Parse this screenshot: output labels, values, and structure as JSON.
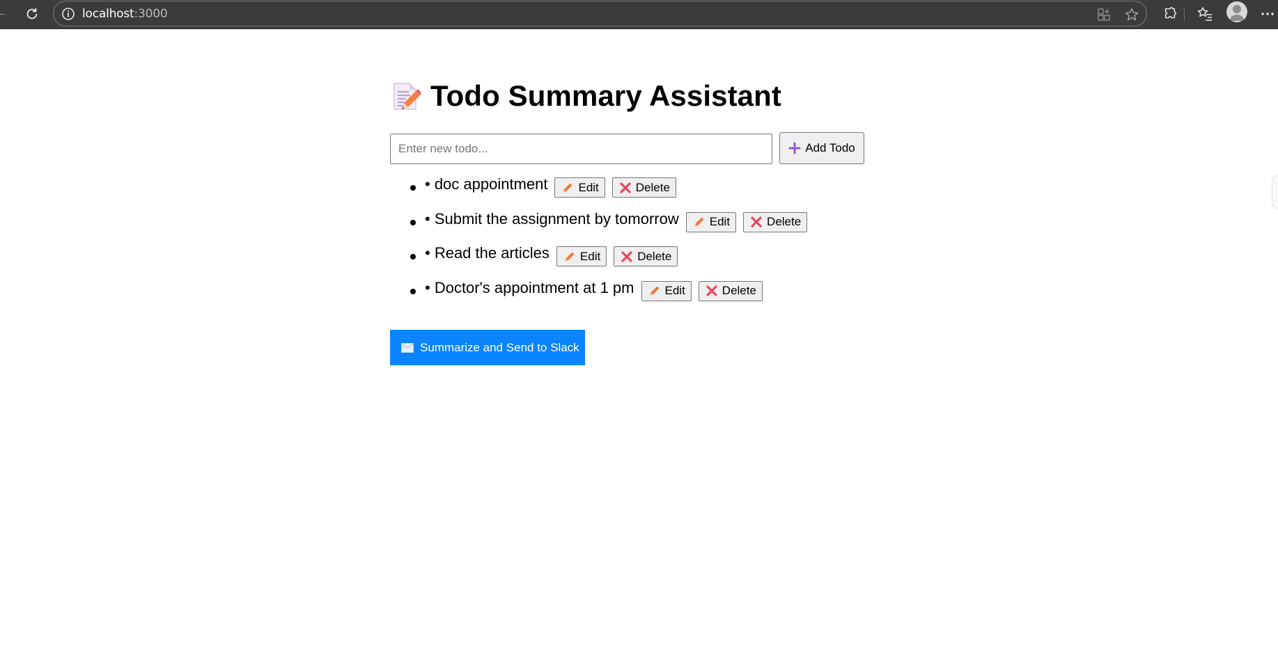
{
  "browser": {
    "url_host": "localhost",
    "url_port": ":3000",
    "icons": [
      "reload-icon",
      "info-icon",
      "app-available-icon",
      "favorite-star-icon",
      "extensions-icon",
      "favorites-icon",
      "profile-avatar",
      "more-menu-icon"
    ]
  },
  "app": {
    "title_icon": "memo-emoji",
    "title": "Todo Summary Assistant",
    "input_placeholder": "Enter new todo...",
    "input_value": "",
    "add_button_icon": "plus-icon",
    "add_button_label": "Add Todo",
    "todos": [
      {
        "text": "• doc appointment",
        "edit_label": "Edit",
        "delete_label": "Delete"
      },
      {
        "text": "• Submit the assignment by tomorrow",
        "edit_label": "Edit",
        "delete_label": "Delete"
      },
      {
        "text": "• Read the articles",
        "edit_label": "Edit",
        "delete_label": "Delete"
      },
      {
        "text": "• Doctor's appointment at 1 pm",
        "edit_label": "Edit",
        "delete_label": "Delete"
      }
    ],
    "summarize_icon": "envelope-icon",
    "summarize_label": "Summarize and Send to Slack"
  },
  "colors": {
    "browser_bar": "#3b3b3b",
    "summarize_button": "#0a84ff",
    "edit_icon": "#f07a3c",
    "delete_icon": "#e8475f",
    "plus_icon": "#8e5bd1"
  }
}
